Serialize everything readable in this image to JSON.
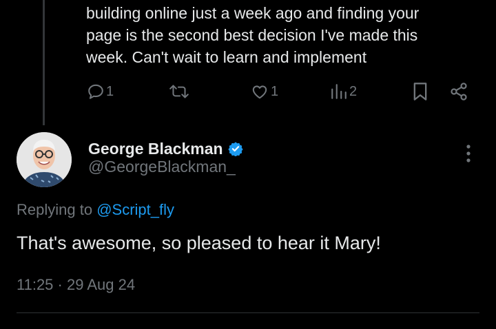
{
  "parent_tweet": {
    "text_line_1": "building online just a week ago and finding your",
    "text_line_2": "page is the second best decision I've made this",
    "text_line_3": "week.  Can't wait to learn and implement",
    "actions": {
      "reply_count": "1",
      "like_count": "1",
      "views_count": "2"
    },
    "icons": [
      "reply-icon",
      "retweet-icon",
      "like-icon",
      "views-icon",
      "bookmark-icon",
      "share-icon"
    ]
  },
  "reply_tweet": {
    "display_name": "George Blackman",
    "handle": "@GeorgeBlackman_",
    "verified": true,
    "replying_prefix": "Replying to ",
    "replying_to": "@Script_fly",
    "text": "That's awesome, so pleased to hear it Mary!",
    "time": "11:25",
    "separator": " · ",
    "date": "29 Aug 24"
  },
  "colors": {
    "background": "#000000",
    "text_primary": "#e7e9ea",
    "text_secondary": "#71767b",
    "accent": "#1d9bf0",
    "divider": "#2f3336"
  }
}
